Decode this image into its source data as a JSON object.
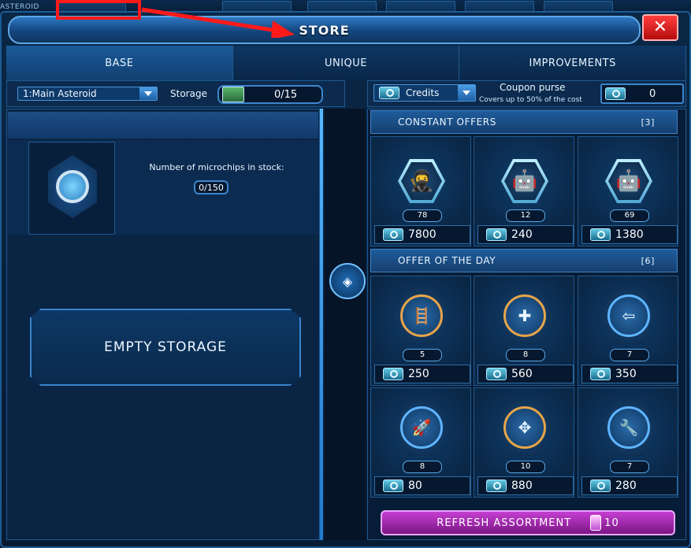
{
  "top": {
    "asteroid_tag": "ASTEROID"
  },
  "store": {
    "title": "STORE",
    "close_icon": "close-icon"
  },
  "tabs": [
    {
      "label": "BASE",
      "active": true
    },
    {
      "label": "UNIQUE",
      "active": false
    },
    {
      "label": "IMPROVEMENTS",
      "active": false
    }
  ],
  "selectors": {
    "asteroid": "1:Main Asteroid",
    "storage_label": "Storage",
    "storage_value": "0/15",
    "currency": "Credits",
    "coupon_title": "Coupon purse",
    "coupon_sub": "Covers up to 50% of the cost",
    "coupon_value": "0"
  },
  "left": {
    "stock_label": "Number of microchips in stock:",
    "stock_value": "0/150",
    "empty_button": "EMPTY STORAGE"
  },
  "constant_offers": {
    "title": "CONSTANT OFFERS",
    "count": "[3]",
    "items": [
      {
        "icon": "hooded-agent-icon",
        "qty": "78",
        "price": "7800"
      },
      {
        "icon": "gold-robot-icon",
        "qty": "12",
        "price": "240"
      },
      {
        "icon": "gold-robot-icon",
        "qty": "69",
        "price": "1380"
      }
    ]
  },
  "offer_of_day": {
    "title": "OFFER OF THE DAY",
    "count": "[6]",
    "items": [
      {
        "icon": "ladder-upgrade-icon",
        "qty": "5",
        "price": "250"
      },
      {
        "icon": "repair-tool-icon",
        "qty": "8",
        "price": "560"
      },
      {
        "icon": "shield-arrow-icon",
        "qty": "7",
        "price": "350"
      },
      {
        "icon": "missile-icon",
        "qty": "8",
        "price": "80"
      },
      {
        "icon": "spread-arrows-icon",
        "qty": "10",
        "price": "880"
      },
      {
        "icon": "wrench-ship-icon",
        "qty": "7",
        "price": "280"
      }
    ]
  },
  "refresh": {
    "label": "REFRESH ASSORTMENT",
    "cost": "10"
  },
  "colors": {
    "accent": "#1f5a92",
    "close": "#d81b1b",
    "refresh": "#a12ab0",
    "annotation": "#ff1a1a"
  }
}
